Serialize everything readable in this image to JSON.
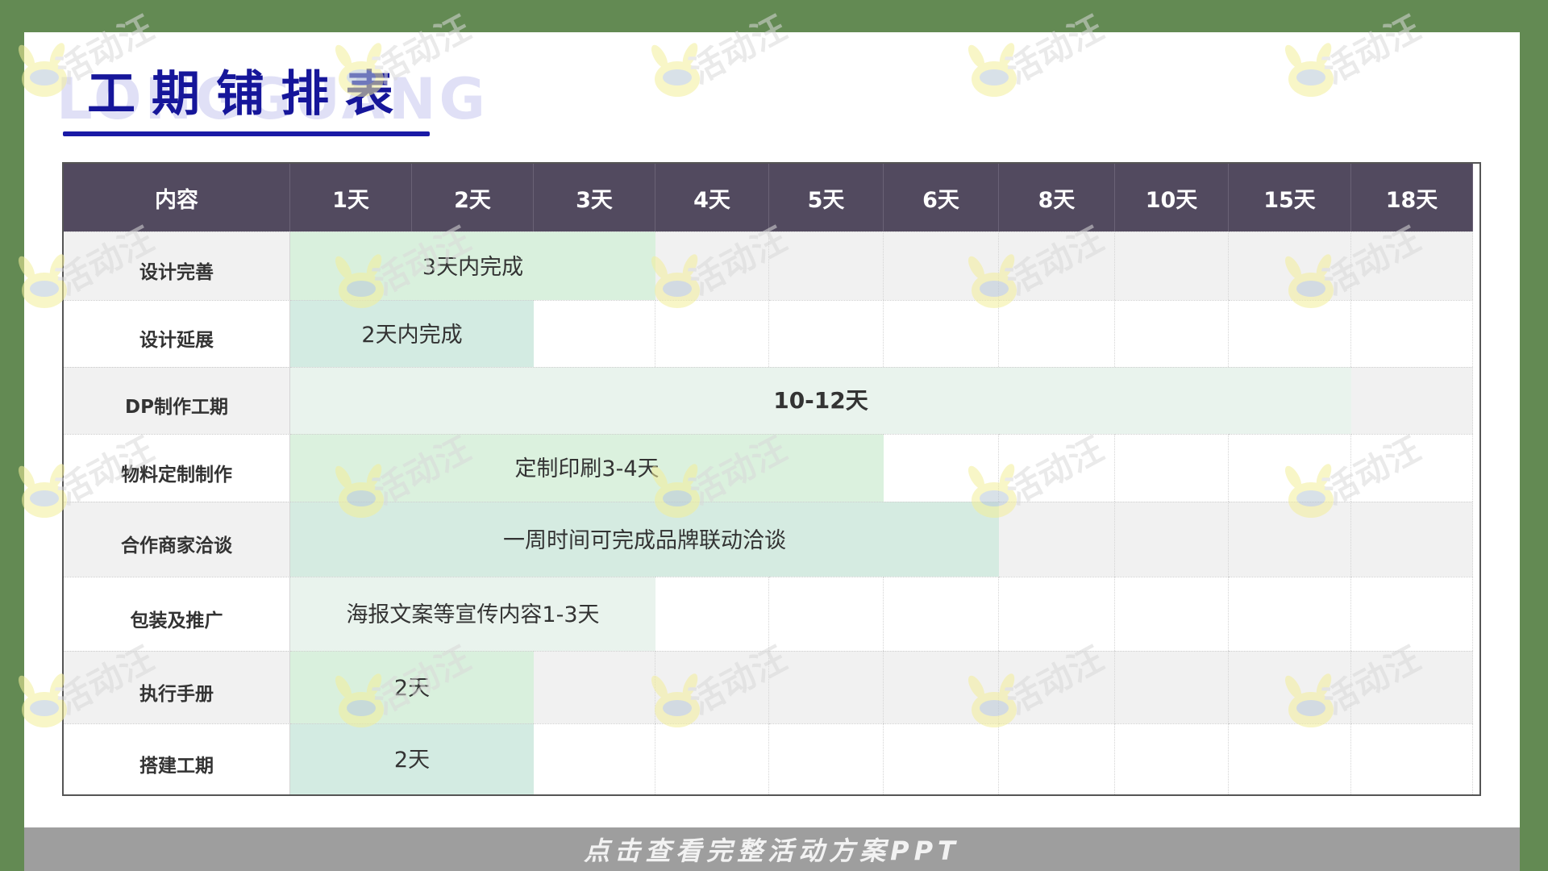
{
  "title": "工期铺排表",
  "title_bg": "LONGGUANG",
  "watermark": "活动汪",
  "table": {
    "header": {
      "label": "内容",
      "days": [
        "1天",
        "2天",
        "3天",
        "4天",
        "5天",
        "6天",
        "8天",
        "10天",
        "15天",
        "18天"
      ]
    },
    "rows": [
      {
        "label": "设计完善",
        "bar_text": "3天内完成",
        "bar_from": 1,
        "bar_span": 3,
        "bar_color": "#d9f0dd",
        "shaded": true
      },
      {
        "label": "设计延展",
        "bar_text": "2天内完成",
        "bar_from": 1,
        "bar_span": 2,
        "bar_color": "#d3ebe2",
        "shaded": false
      },
      {
        "label": "DP制作工期",
        "bar_text": "10-12天",
        "bar_from": 1,
        "bar_span": 9,
        "bar_color": "#e9f3ed",
        "shaded": true
      },
      {
        "label": "物料定制制作",
        "bar_text": "定制印刷3-4天",
        "bar_from": 1,
        "bar_span": 5,
        "bar_color": "#dbf1de",
        "shaded": false
      },
      {
        "label": "合作商家洽谈",
        "bar_text": "一周时间可完成品牌联动洽谈",
        "bar_from": 1,
        "bar_span": 6,
        "bar_color": "#d5ebe1",
        "shaded": true
      },
      {
        "label": "包装及推广",
        "bar_text": "海报文案等宣传内容1-3天",
        "bar_from": 1,
        "bar_span": 3,
        "bar_color": "#e9f3ed",
        "shaded": false
      },
      {
        "label": "执行手册",
        "bar_text": "2天",
        "bar_from": 1,
        "bar_span": 2,
        "bar_color": "#d9f0dd",
        "shaded": true
      },
      {
        "label": "搭建工期",
        "bar_text": "2天",
        "bar_from": 1,
        "bar_span": 2,
        "bar_color": "#d3ebe2",
        "shaded": false
      }
    ]
  },
  "footer": {
    "text": "点击查看完整活动方案PPT"
  }
}
